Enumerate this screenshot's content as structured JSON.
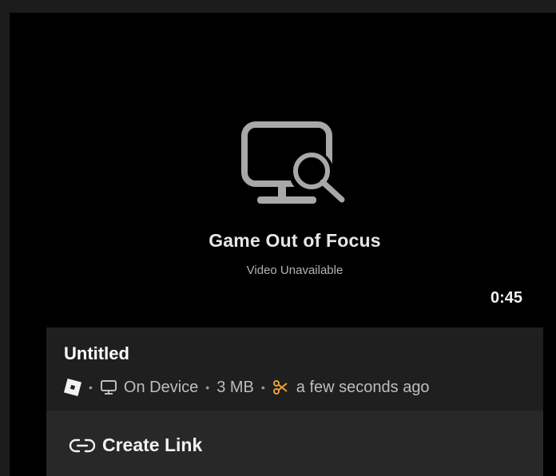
{
  "preview": {
    "status_icon": "monitor-search-icon",
    "status_title": "Game Out of Focus",
    "status_subtitle": "Video Unavailable",
    "duration": "0:45"
  },
  "clip": {
    "title": "Untitled",
    "source_icon": "roblox-logo-icon",
    "storage_icon": "monitor-icon",
    "storage_label": "On Device",
    "size": "3 MB",
    "clip_icon": "scissors-icon",
    "timestamp": "a few seconds ago",
    "separator": "•"
  },
  "actions": {
    "create_link_icon": "link-icon",
    "create_link_label": "Create Link"
  },
  "colors": {
    "background": "#000000",
    "panel": "#1f1f1f",
    "action_panel": "#282828",
    "accent": "#f0a030",
    "icon_gray": "#a8a8a8"
  }
}
